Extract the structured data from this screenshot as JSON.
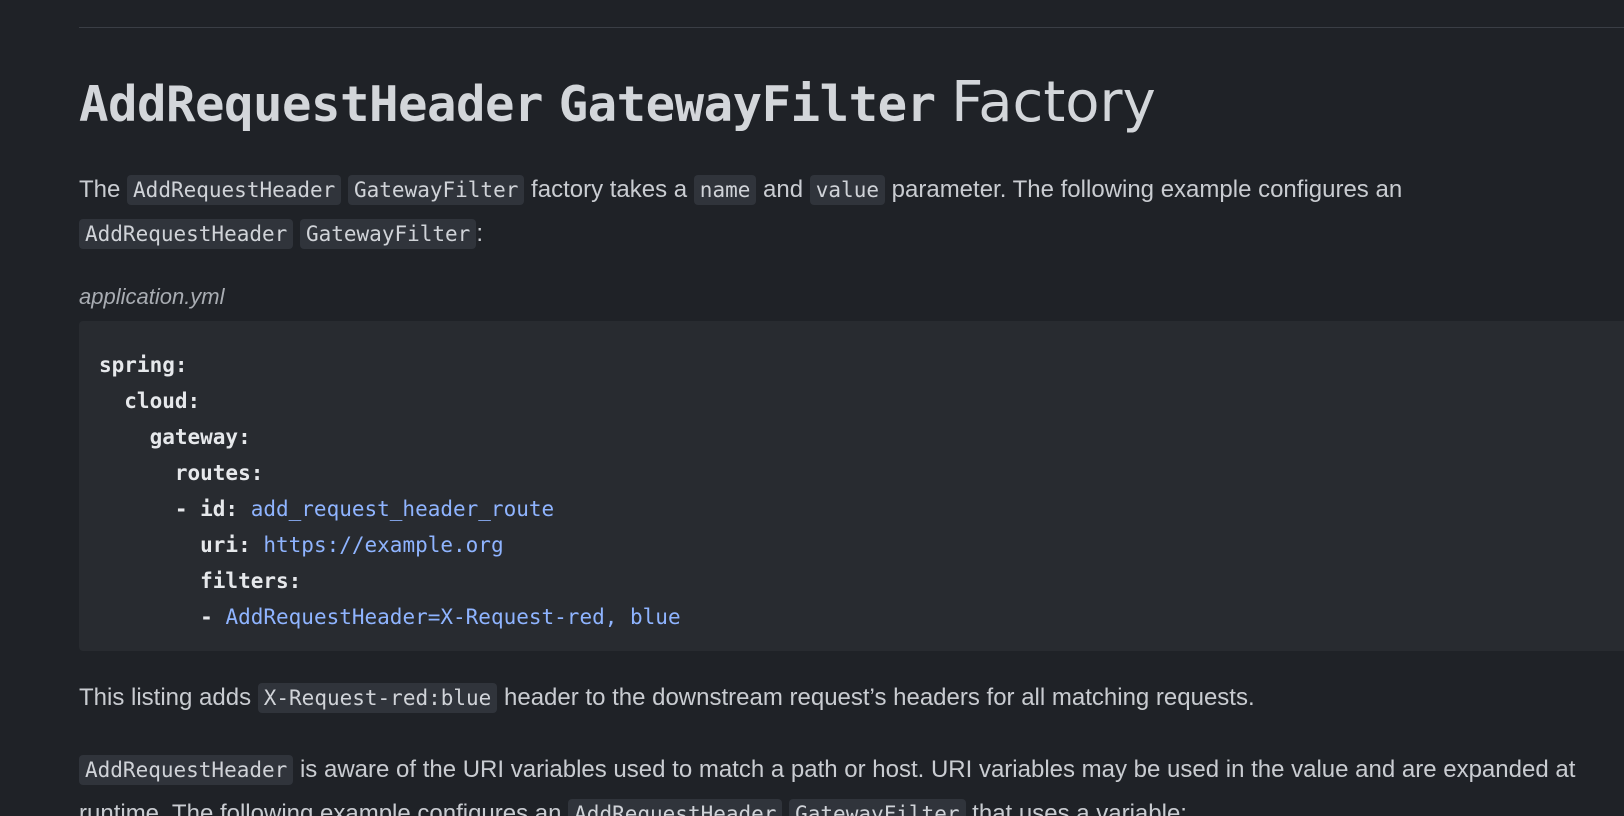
{
  "heading": {
    "code1": "AddRequestHeader",
    "code2": "GatewayFilter",
    "text": "Factory"
  },
  "intro": {
    "t1": "The",
    "c1": "AddRequestHeader",
    "c2": "GatewayFilter",
    "t2": "factory takes a",
    "c3": "name",
    "t3": "and",
    "c4": "value",
    "t4": "parameter. The following example configures an",
    "c5": "AddRequestHeader",
    "c6": "GatewayFilter",
    "t5": ":"
  },
  "caption": "application.yml",
  "code": {
    "l1": "spring:",
    "l2": "  cloud:",
    "l3": "    gateway:",
    "l4": "      routes:",
    "l5_key": "      - id: ",
    "l5_val": "add_request_header_route",
    "l6_key": "        uri: ",
    "l6_val": "https://example.org",
    "l7": "        filters:",
    "l8_key": "        - ",
    "l8_val": "AddRequestHeader=X-Request-red, blue"
  },
  "listing": {
    "t1": "This listing adds",
    "c1": "X-Request-red:blue",
    "t2": "header to the downstream request’s headers for all matching requests."
  },
  "aware": {
    "c1": "AddRequestHeader",
    "t1": "is aware of the URI variables used to match a path or host. URI variables may be used in the value and are expanded at",
    "t2": "runtime. The following example configures an",
    "c2": "AddRequestHeader",
    "c3": "GatewayFilter",
    "t3": "that uses a variable:"
  }
}
